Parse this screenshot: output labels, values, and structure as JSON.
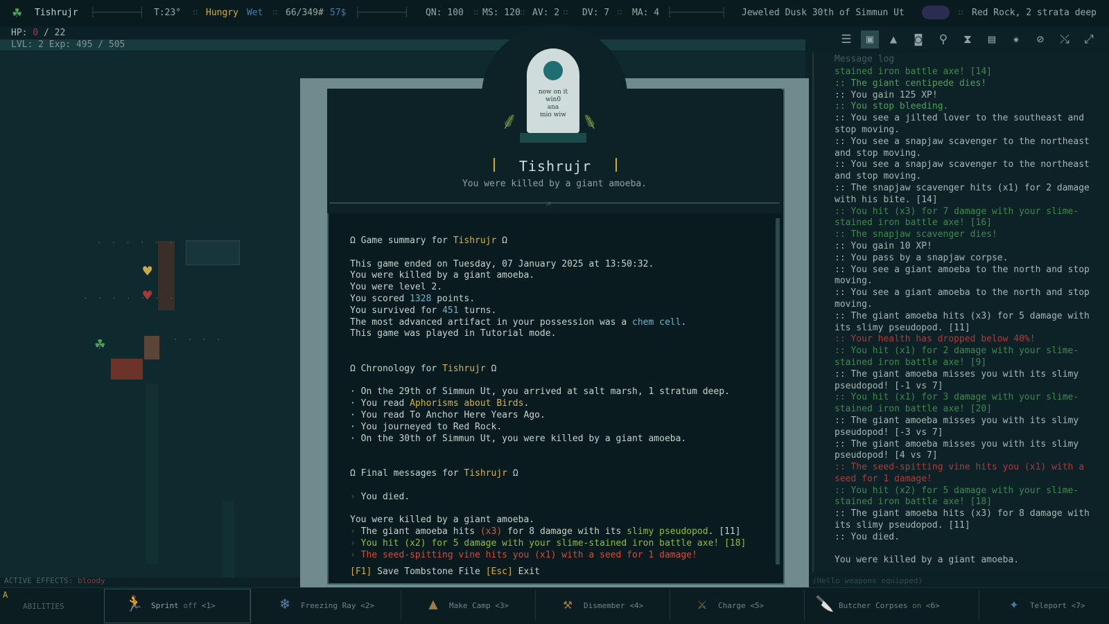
{
  "topbar": {
    "name": "Tishrujr",
    "temp": "T:23°",
    "hunger": "Hungry",
    "wet": "Wet",
    "weight": "66/349#",
    "money": "57$",
    "qn": "QN: 100",
    "ms": "MS: 120",
    "av": "AV: 2",
    "dv": "DV: 7",
    "ma": "MA: 4",
    "date": "Jeweled Dusk 30th of Simmun Ut",
    "location": "Red Rock, 2 strata deep"
  },
  "stats": {
    "hp_label": "HP:",
    "hp_current": "0",
    "hp_sep": "/ 22",
    "lvl": "LVL: 2 Exp: 495 / 505"
  },
  "log": {
    "title": "Message log",
    "lines": [
      {
        "t": "stained iron battle axe! [14]",
        "c": "g"
      },
      {
        "t": ":: The giant centipede dies!",
        "c": "gx"
      },
      {
        "t": ":: You gain 125 XP!",
        "c": ""
      },
      {
        "t": ":: You stop bleeding.",
        "c": "gx"
      },
      {
        "t": ":: You see a jilted lover to the southeast and",
        "c": "jl"
      },
      {
        "t": "stop moving.",
        "c": ""
      },
      {
        "t": ":: You see a snapjaw scavenger to the northeast",
        "c": ""
      },
      {
        "t": "and stop moving.",
        "c": ""
      },
      {
        "t": ":: You see a snapjaw scavenger to the northeast",
        "c": ""
      },
      {
        "t": "and stop moving.",
        "c": ""
      },
      {
        "t": ":: The snapjaw scavenger hits (x1) for 2 damage",
        "c": "x1"
      },
      {
        "t": "with his bite. [14]",
        "c": ""
      },
      {
        "t": ":: You hit (x3) for 7 damage with your slime-",
        "c": "g"
      },
      {
        "t": "stained iron battle axe! [16]",
        "c": "g"
      },
      {
        "t": ":: The snapjaw scavenger dies!",
        "c": "g"
      },
      {
        "t": ":: You gain 10 XP!",
        "c": ""
      },
      {
        "t": ":: You pass by a snapjaw corpse.",
        "c": ""
      },
      {
        "t": ":: You see a giant amoeba to the north and stop",
        "c": ""
      },
      {
        "t": "moving.",
        "c": ""
      },
      {
        "t": ":: You see a giant amoeba to the north and stop",
        "c": ""
      },
      {
        "t": "moving.",
        "c": ""
      },
      {
        "t": ":: The giant amoeba hits (x3) for 5 damage with",
        "c": "x3"
      },
      {
        "t": "its slimy pseudopod. [11]",
        "c": "sp"
      },
      {
        "t": ":: Your health has dropped below 40%!",
        "c": "rh"
      },
      {
        "t": ":: You hit (x1) for 2 damage with your slime-",
        "c": "g"
      },
      {
        "t": "stained iron battle axe! [9]",
        "c": "g"
      },
      {
        "t": ":: The giant amoeba misses you with its slimy",
        "c": "ms"
      },
      {
        "t": "pseudopod! [-1 vs 7]",
        "c": "ps"
      },
      {
        "t": ":: You hit (x1) for 3 damage with your slime-",
        "c": "g"
      },
      {
        "t": "stained iron battle axe! [20]",
        "c": "g"
      },
      {
        "t": ":: The giant amoeba misses you with its slimy",
        "c": "ms"
      },
      {
        "t": "pseudopod! [-3 vs 7]",
        "c": "ps"
      },
      {
        "t": ":: The giant amoeba misses you with its slimy",
        "c": "ms"
      },
      {
        "t": "pseudopod! [4 vs 7]",
        "c": "ps"
      },
      {
        "t": ":: The seed-spitting vine hits you (x1) with a",
        "c": "r"
      },
      {
        "t": "seed for 1 damage!",
        "c": "r"
      },
      {
        "t": ":: You hit (x2) for 5 damage with your slime-",
        "c": "g"
      },
      {
        "t": "stained iron battle axe! [18]",
        "c": "g"
      },
      {
        "t": ":: The giant amoeba hits (x3) for 8 damage with",
        "c": "x3"
      },
      {
        "t": "its slimy pseudopod. [11]",
        "c": "sp"
      },
      {
        "t": ":: You died.",
        "c": ""
      },
      {
        "t": "",
        "c": ""
      },
      {
        "t": "You were killed by a giant amoeba.",
        "c": ""
      }
    ]
  },
  "tombstone": {
    "inscription": [
      "now on it",
      "win0",
      "ana",
      "mio wiw"
    ],
    "name": "Tishrujr",
    "death": "You were killed by a giant amoeba."
  },
  "summary": {
    "h1_pre": "Ω Game summary for ",
    "h1_name": "Tishrujr",
    "h1_post": " Ω",
    "ended": "This game ended on Tuesday, 07 January 2025 at 13:50:32.",
    "killed": "You were killed by a giant amoeba.",
    "level": "You were level 2.",
    "scored_pre": "You scored ",
    "scored_val": "1328",
    "scored_post": " points.",
    "survived_pre": "You survived for ",
    "survived_val": "451",
    "survived_post": " turns.",
    "artifact_pre": "The most advanced artifact in your possession was a ",
    "artifact_val": "chem cell",
    "artifact_post": ".",
    "mode": "This game was played in Tutorial mode.",
    "h2_pre": "Ω Chronology for ",
    "h2_post": " Ω",
    "chron1": "· On the 29th of Simmun Ut, you arrived at salt marsh, 1 stratum deep.",
    "chron2_pre": "· You read ",
    "chron2_val": "Aphorisms about Birds",
    "chron2_post": ".",
    "chron3": "· You read To Anchor Here Years Ago.",
    "chron4": "· You journeyed to Red Rock.",
    "chron5": "· On the 30th of Simmun Ut, you were killed by a giant amoeba.",
    "h3_pre": "Ω Final messages for ",
    "h3_post": " Ω",
    "died": "You died.",
    "killed2": "You were killed by a giant amoeba.",
    "fm1_pre": "The giant amoeba hits ",
    "fm1_x": "(x3)",
    "fm1_mid": " for 8 damage with its ",
    "fm1_val": "slimy pseudopod",
    "fm1_post": ". [11]",
    "fm2": "You hit (x2) for 5 damage with your slime-stained iron battle axe! [18]",
    "fm3": "The seed-spitting vine hits you (x1) with a seed for 1 damage!"
  },
  "footer": {
    "f1_key": "[F1]",
    "f1_label": "Save Tombstone File",
    "esc_key": "[Esc]",
    "esc_label": "Exit"
  },
  "effects": {
    "label": "ACTIVE EFFECTS:",
    "value": "bloody"
  },
  "footer_hint": "(Hello weapons equipped)",
  "abilities": {
    "title": "ABILITIES",
    "items": [
      {
        "label": "Sprint",
        "state": "off",
        "key": "<1>"
      },
      {
        "label": "Freezing Ray",
        "state": "",
        "key": "<2>"
      },
      {
        "label": "Make Camp",
        "state": "",
        "key": "<3>"
      },
      {
        "label": "Dismember",
        "state": "",
        "key": "<4>"
      },
      {
        "label": "Charge",
        "state": "",
        "key": "<5>"
      },
      {
        "label": "Butcher Corpses",
        "state": "on",
        "key": "<6>"
      },
      {
        "label": "Teleport",
        "state": "",
        "key": "<7>"
      }
    ]
  },
  "colors": {
    "accent_yellow": "#cfae3e",
    "accent_green": "#4f9e5d",
    "accent_red": "#b2383a",
    "panel_bg": "#0a1b1f"
  },
  "icons": [
    "menu-icon",
    "equipment-icon",
    "character-icon",
    "inventory-icon",
    "search-icon",
    "hourglass-icon",
    "journal-icon",
    "tinker-icon",
    "quests-icon",
    "rest-icon",
    "expand-icon"
  ]
}
